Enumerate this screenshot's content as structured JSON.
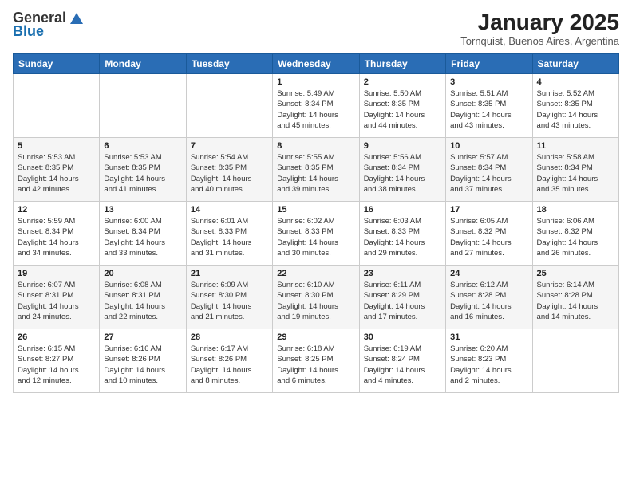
{
  "header": {
    "logo_general": "General",
    "logo_blue": "Blue",
    "month_title": "January 2025",
    "location": "Tornquist, Buenos Aires, Argentina"
  },
  "weekdays": [
    "Sunday",
    "Monday",
    "Tuesday",
    "Wednesday",
    "Thursday",
    "Friday",
    "Saturday"
  ],
  "weeks": [
    [
      {
        "day": "",
        "info": ""
      },
      {
        "day": "",
        "info": ""
      },
      {
        "day": "",
        "info": ""
      },
      {
        "day": "1",
        "info": "Sunrise: 5:49 AM\nSunset: 8:34 PM\nDaylight: 14 hours\nand 45 minutes."
      },
      {
        "day": "2",
        "info": "Sunrise: 5:50 AM\nSunset: 8:35 PM\nDaylight: 14 hours\nand 44 minutes."
      },
      {
        "day": "3",
        "info": "Sunrise: 5:51 AM\nSunset: 8:35 PM\nDaylight: 14 hours\nand 43 minutes."
      },
      {
        "day": "4",
        "info": "Sunrise: 5:52 AM\nSunset: 8:35 PM\nDaylight: 14 hours\nand 43 minutes."
      }
    ],
    [
      {
        "day": "5",
        "info": "Sunrise: 5:53 AM\nSunset: 8:35 PM\nDaylight: 14 hours\nand 42 minutes."
      },
      {
        "day": "6",
        "info": "Sunrise: 5:53 AM\nSunset: 8:35 PM\nDaylight: 14 hours\nand 41 minutes."
      },
      {
        "day": "7",
        "info": "Sunrise: 5:54 AM\nSunset: 8:35 PM\nDaylight: 14 hours\nand 40 minutes."
      },
      {
        "day": "8",
        "info": "Sunrise: 5:55 AM\nSunset: 8:35 PM\nDaylight: 14 hours\nand 39 minutes."
      },
      {
        "day": "9",
        "info": "Sunrise: 5:56 AM\nSunset: 8:34 PM\nDaylight: 14 hours\nand 38 minutes."
      },
      {
        "day": "10",
        "info": "Sunrise: 5:57 AM\nSunset: 8:34 PM\nDaylight: 14 hours\nand 37 minutes."
      },
      {
        "day": "11",
        "info": "Sunrise: 5:58 AM\nSunset: 8:34 PM\nDaylight: 14 hours\nand 35 minutes."
      }
    ],
    [
      {
        "day": "12",
        "info": "Sunrise: 5:59 AM\nSunset: 8:34 PM\nDaylight: 14 hours\nand 34 minutes."
      },
      {
        "day": "13",
        "info": "Sunrise: 6:00 AM\nSunset: 8:34 PM\nDaylight: 14 hours\nand 33 minutes."
      },
      {
        "day": "14",
        "info": "Sunrise: 6:01 AM\nSunset: 8:33 PM\nDaylight: 14 hours\nand 31 minutes."
      },
      {
        "day": "15",
        "info": "Sunrise: 6:02 AM\nSunset: 8:33 PM\nDaylight: 14 hours\nand 30 minutes."
      },
      {
        "day": "16",
        "info": "Sunrise: 6:03 AM\nSunset: 8:33 PM\nDaylight: 14 hours\nand 29 minutes."
      },
      {
        "day": "17",
        "info": "Sunrise: 6:05 AM\nSunset: 8:32 PM\nDaylight: 14 hours\nand 27 minutes."
      },
      {
        "day": "18",
        "info": "Sunrise: 6:06 AM\nSunset: 8:32 PM\nDaylight: 14 hours\nand 26 minutes."
      }
    ],
    [
      {
        "day": "19",
        "info": "Sunrise: 6:07 AM\nSunset: 8:31 PM\nDaylight: 14 hours\nand 24 minutes."
      },
      {
        "day": "20",
        "info": "Sunrise: 6:08 AM\nSunset: 8:31 PM\nDaylight: 14 hours\nand 22 minutes."
      },
      {
        "day": "21",
        "info": "Sunrise: 6:09 AM\nSunset: 8:30 PM\nDaylight: 14 hours\nand 21 minutes."
      },
      {
        "day": "22",
        "info": "Sunrise: 6:10 AM\nSunset: 8:30 PM\nDaylight: 14 hours\nand 19 minutes."
      },
      {
        "day": "23",
        "info": "Sunrise: 6:11 AM\nSunset: 8:29 PM\nDaylight: 14 hours\nand 17 minutes."
      },
      {
        "day": "24",
        "info": "Sunrise: 6:12 AM\nSunset: 8:28 PM\nDaylight: 14 hours\nand 16 minutes."
      },
      {
        "day": "25",
        "info": "Sunrise: 6:14 AM\nSunset: 8:28 PM\nDaylight: 14 hours\nand 14 minutes."
      }
    ],
    [
      {
        "day": "26",
        "info": "Sunrise: 6:15 AM\nSunset: 8:27 PM\nDaylight: 14 hours\nand 12 minutes."
      },
      {
        "day": "27",
        "info": "Sunrise: 6:16 AM\nSunset: 8:26 PM\nDaylight: 14 hours\nand 10 minutes."
      },
      {
        "day": "28",
        "info": "Sunrise: 6:17 AM\nSunset: 8:26 PM\nDaylight: 14 hours\nand 8 minutes."
      },
      {
        "day": "29",
        "info": "Sunrise: 6:18 AM\nSunset: 8:25 PM\nDaylight: 14 hours\nand 6 minutes."
      },
      {
        "day": "30",
        "info": "Sunrise: 6:19 AM\nSunset: 8:24 PM\nDaylight: 14 hours\nand 4 minutes."
      },
      {
        "day": "31",
        "info": "Sunrise: 6:20 AM\nSunset: 8:23 PM\nDaylight: 14 hours\nand 2 minutes."
      },
      {
        "day": "",
        "info": ""
      }
    ]
  ]
}
